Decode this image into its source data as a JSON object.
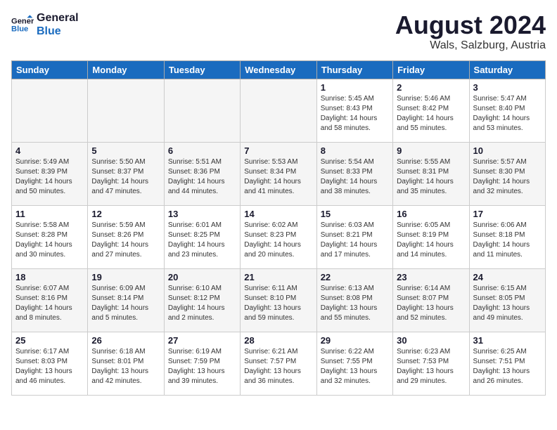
{
  "header": {
    "logo_line1": "General",
    "logo_line2": "Blue",
    "month_year": "August 2024",
    "location": "Wals, Salzburg, Austria"
  },
  "days_of_week": [
    "Sunday",
    "Monday",
    "Tuesday",
    "Wednesday",
    "Thursday",
    "Friday",
    "Saturday"
  ],
  "weeks": [
    [
      {
        "day": "",
        "info": ""
      },
      {
        "day": "",
        "info": ""
      },
      {
        "day": "",
        "info": ""
      },
      {
        "day": "",
        "info": ""
      },
      {
        "day": "1",
        "info": "Sunrise: 5:45 AM\nSunset: 8:43 PM\nDaylight: 14 hours\nand 58 minutes."
      },
      {
        "day": "2",
        "info": "Sunrise: 5:46 AM\nSunset: 8:42 PM\nDaylight: 14 hours\nand 55 minutes."
      },
      {
        "day": "3",
        "info": "Sunrise: 5:47 AM\nSunset: 8:40 PM\nDaylight: 14 hours\nand 53 minutes."
      }
    ],
    [
      {
        "day": "4",
        "info": "Sunrise: 5:49 AM\nSunset: 8:39 PM\nDaylight: 14 hours\nand 50 minutes."
      },
      {
        "day": "5",
        "info": "Sunrise: 5:50 AM\nSunset: 8:37 PM\nDaylight: 14 hours\nand 47 minutes."
      },
      {
        "day": "6",
        "info": "Sunrise: 5:51 AM\nSunset: 8:36 PM\nDaylight: 14 hours\nand 44 minutes."
      },
      {
        "day": "7",
        "info": "Sunrise: 5:53 AM\nSunset: 8:34 PM\nDaylight: 14 hours\nand 41 minutes."
      },
      {
        "day": "8",
        "info": "Sunrise: 5:54 AM\nSunset: 8:33 PM\nDaylight: 14 hours\nand 38 minutes."
      },
      {
        "day": "9",
        "info": "Sunrise: 5:55 AM\nSunset: 8:31 PM\nDaylight: 14 hours\nand 35 minutes."
      },
      {
        "day": "10",
        "info": "Sunrise: 5:57 AM\nSunset: 8:30 PM\nDaylight: 14 hours\nand 32 minutes."
      }
    ],
    [
      {
        "day": "11",
        "info": "Sunrise: 5:58 AM\nSunset: 8:28 PM\nDaylight: 14 hours\nand 30 minutes."
      },
      {
        "day": "12",
        "info": "Sunrise: 5:59 AM\nSunset: 8:26 PM\nDaylight: 14 hours\nand 27 minutes."
      },
      {
        "day": "13",
        "info": "Sunrise: 6:01 AM\nSunset: 8:25 PM\nDaylight: 14 hours\nand 23 minutes."
      },
      {
        "day": "14",
        "info": "Sunrise: 6:02 AM\nSunset: 8:23 PM\nDaylight: 14 hours\nand 20 minutes."
      },
      {
        "day": "15",
        "info": "Sunrise: 6:03 AM\nSunset: 8:21 PM\nDaylight: 14 hours\nand 17 minutes."
      },
      {
        "day": "16",
        "info": "Sunrise: 6:05 AM\nSunset: 8:19 PM\nDaylight: 14 hours\nand 14 minutes."
      },
      {
        "day": "17",
        "info": "Sunrise: 6:06 AM\nSunset: 8:18 PM\nDaylight: 14 hours\nand 11 minutes."
      }
    ],
    [
      {
        "day": "18",
        "info": "Sunrise: 6:07 AM\nSunset: 8:16 PM\nDaylight: 14 hours\nand 8 minutes."
      },
      {
        "day": "19",
        "info": "Sunrise: 6:09 AM\nSunset: 8:14 PM\nDaylight: 14 hours\nand 5 minutes."
      },
      {
        "day": "20",
        "info": "Sunrise: 6:10 AM\nSunset: 8:12 PM\nDaylight: 14 hours\nand 2 minutes."
      },
      {
        "day": "21",
        "info": "Sunrise: 6:11 AM\nSunset: 8:10 PM\nDaylight: 13 hours\nand 59 minutes."
      },
      {
        "day": "22",
        "info": "Sunrise: 6:13 AM\nSunset: 8:08 PM\nDaylight: 13 hours\nand 55 minutes."
      },
      {
        "day": "23",
        "info": "Sunrise: 6:14 AM\nSunset: 8:07 PM\nDaylight: 13 hours\nand 52 minutes."
      },
      {
        "day": "24",
        "info": "Sunrise: 6:15 AM\nSunset: 8:05 PM\nDaylight: 13 hours\nand 49 minutes."
      }
    ],
    [
      {
        "day": "25",
        "info": "Sunrise: 6:17 AM\nSunset: 8:03 PM\nDaylight: 13 hours\nand 46 minutes."
      },
      {
        "day": "26",
        "info": "Sunrise: 6:18 AM\nSunset: 8:01 PM\nDaylight: 13 hours\nand 42 minutes."
      },
      {
        "day": "27",
        "info": "Sunrise: 6:19 AM\nSunset: 7:59 PM\nDaylight: 13 hours\nand 39 minutes."
      },
      {
        "day": "28",
        "info": "Sunrise: 6:21 AM\nSunset: 7:57 PM\nDaylight: 13 hours\nand 36 minutes."
      },
      {
        "day": "29",
        "info": "Sunrise: 6:22 AM\nSunset: 7:55 PM\nDaylight: 13 hours\nand 32 minutes."
      },
      {
        "day": "30",
        "info": "Sunrise: 6:23 AM\nSunset: 7:53 PM\nDaylight: 13 hours\nand 29 minutes."
      },
      {
        "day": "31",
        "info": "Sunrise: 6:25 AM\nSunset: 7:51 PM\nDaylight: 13 hours\nand 26 minutes."
      }
    ]
  ]
}
